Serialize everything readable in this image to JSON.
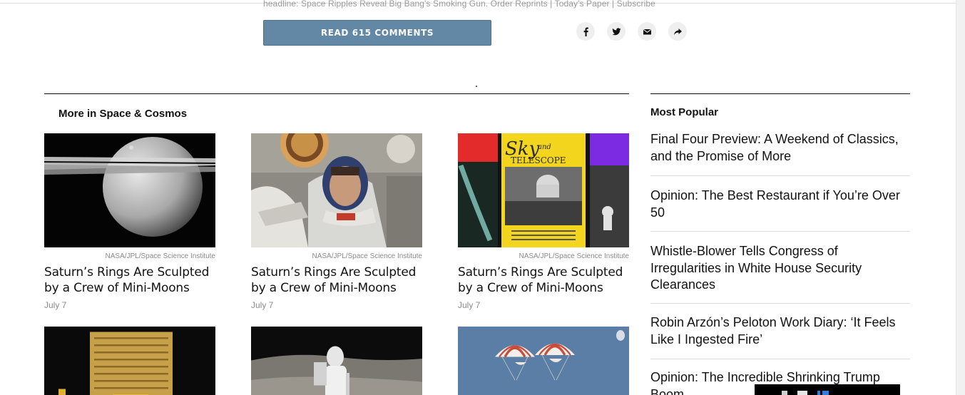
{
  "article": {
    "headline_ref": "headline: Space Ripples Reveal Big Bang's Smoking Gun. Order Reprints | Today's Paper | Subscribe",
    "comments_label": "READ 615 COMMENTS"
  },
  "share": {
    "icons": [
      "facebook-icon",
      "twitter-icon",
      "email-icon",
      "share-icon"
    ]
  },
  "more_section": {
    "title": "More in Space & Cosmos",
    "cards": [
      {
        "credit": "NASA/JPL/Space Science Institute",
        "title": "Saturn’s Rings Are Sculpted by a Crew of Mini-Moons",
        "date": "July 7"
      },
      {
        "credit": "NASA/JPL/Space Science Institute",
        "title": "Saturn’s Rings Are Sculpted by a Crew of Mini-Moons",
        "date": "July 7"
      },
      {
        "credit": "NASA/JPL/Space Science Institute",
        "title": "Saturn’s Rings Are Sculpted by a Crew of Mini-Moons",
        "date": "July 7"
      }
    ],
    "magazine": {
      "masthead_line1": "Sky",
      "masthead_and": "and",
      "masthead_line2": "TELESCOPE"
    }
  },
  "most_popular": {
    "title": "Most Popular",
    "items": [
      "Final Four Preview: A Weekend of Classics, and the Promise of More",
      "Opinion: The Best Restaurant if You’re Over 50",
      "Whistle-Blower Tells Congress of Irregularities in White House Security Clearances",
      "Robin Arzón’s Peloton Work Diary: ‘It Feels Like I Ingested Fire’",
      "Opinion: The Incredible Shrinking Trump Boom"
    ]
  },
  "colors": {
    "comments_button": "#6288a5",
    "text": "#121212",
    "muted": "#8a8a8a"
  }
}
